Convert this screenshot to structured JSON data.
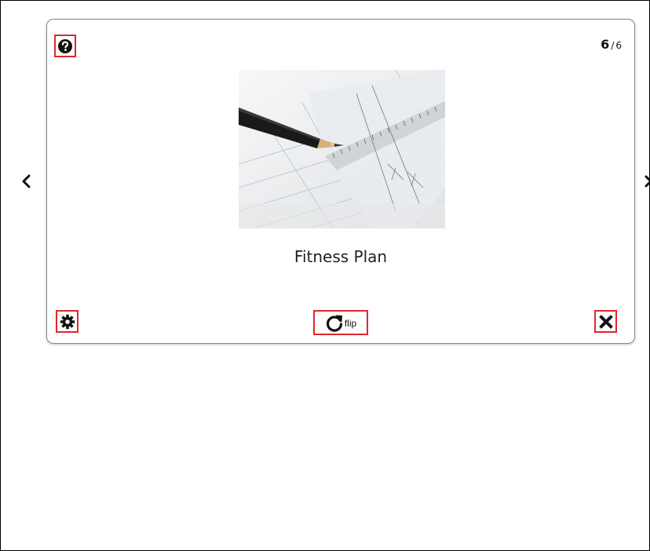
{
  "card": {
    "counter": {
      "current": "6",
      "separator": "/",
      "total": "6"
    },
    "title": "Fitness Plan",
    "flip_label": "flip"
  },
  "icons": {
    "help": "question-circle-icon",
    "settings": "gear-icon",
    "flip": "rotate-icon",
    "close": "close-icon",
    "prev": "chevron-left-icon",
    "next": "chevron-right-icon"
  },
  "colors": {
    "highlight": "#e0262b",
    "card_border": "#8a8a8a"
  }
}
